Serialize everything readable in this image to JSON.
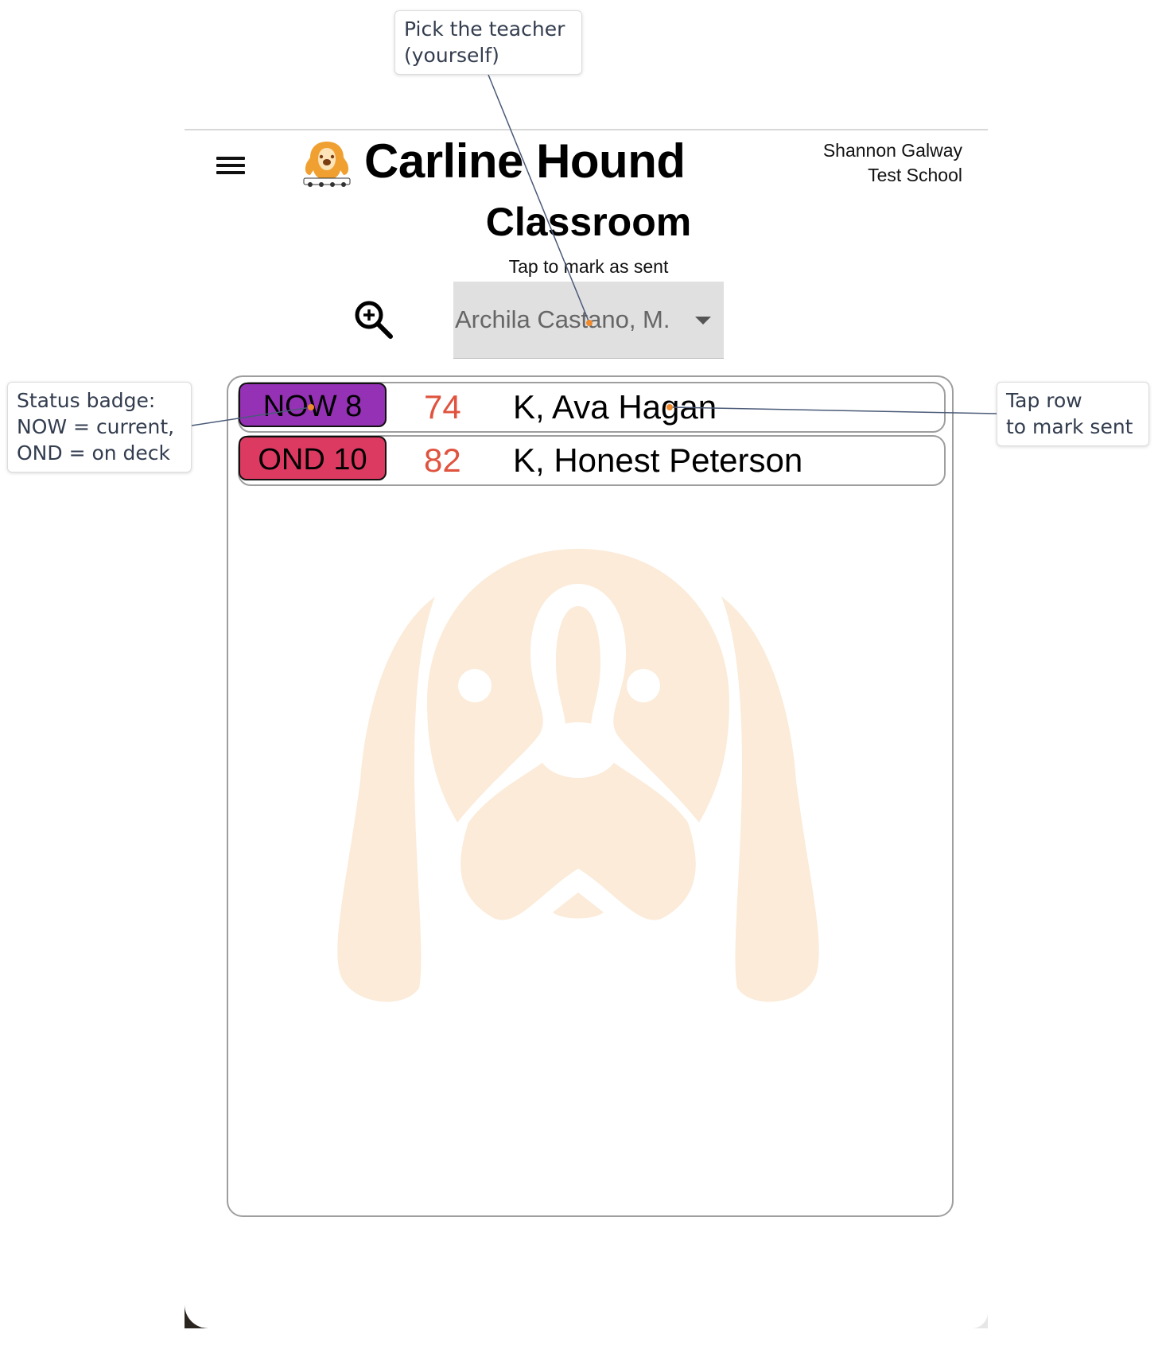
{
  "header": {
    "app_title": "Carline Hound",
    "user_name": "Shannon Galway",
    "school_name": "Test School"
  },
  "page": {
    "title": "Classroom",
    "subtitle": "Tap to mark as sent"
  },
  "teacher_select": {
    "value": "Archila Castano, M."
  },
  "students": [
    {
      "badge": "NOW 8",
      "badge_color": "#9531b5",
      "car": "74",
      "name": "K, Ava Hagan"
    },
    {
      "badge": "OND 10",
      "badge_color": "#dd3a62",
      "car": "82",
      "name": "K, Honest Peterson"
    }
  ],
  "callouts": {
    "teacher": [
      "Pick the teacher",
      "(yourself)"
    ],
    "badge": [
      "Status badge:",
      "NOW = current,",
      "OND = on deck"
    ],
    "row": [
      "Tap row",
      "to mark sent"
    ]
  },
  "colors": {
    "car_number": "#e0533e",
    "watermark": "#fbebd8",
    "callout_line": "#4a5a78",
    "callout_dot": "#f08a2c"
  },
  "icons": {
    "menu": "hamburger-icon",
    "zoom": "zoom-in-icon",
    "logo": "hound-logo",
    "dropdown": "caret-down-icon"
  }
}
